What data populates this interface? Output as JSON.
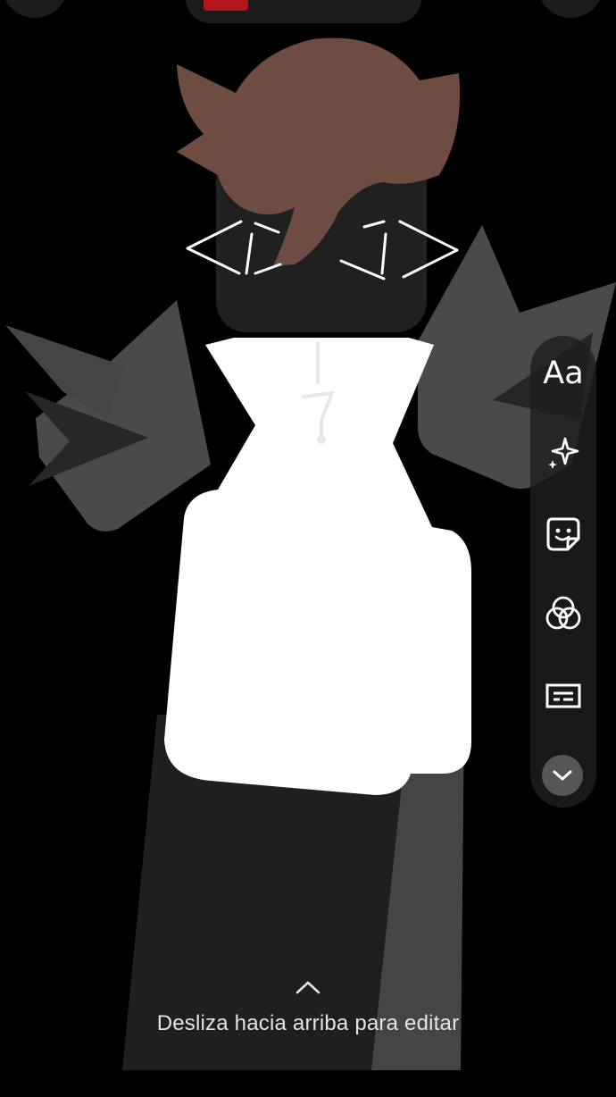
{
  "story_editor": {
    "top_bar": {
      "music_thumb_color": "#b3151b"
    },
    "tools": [
      {
        "label": "Aa",
        "icon": "text-icon"
      },
      {
        "icon": "sparkle-icon"
      },
      {
        "icon": "sticker-icon"
      },
      {
        "icon": "effects-icon"
      },
      {
        "icon": "captions-icon"
      }
    ],
    "collapse_icon": "chevron-down-icon",
    "swipe_hint": {
      "icon": "chevron-up-icon",
      "text": "Desliza hacia arriba para editar"
    }
  },
  "colors": {
    "background": "#000000",
    "panel": "#1e1e1e",
    "hair": "#6e4c41",
    "body_dark": "#1f1f1f",
    "body_grey": "#454545",
    "spike_grey": "#4a4a4a",
    "white": "#ffffff"
  }
}
